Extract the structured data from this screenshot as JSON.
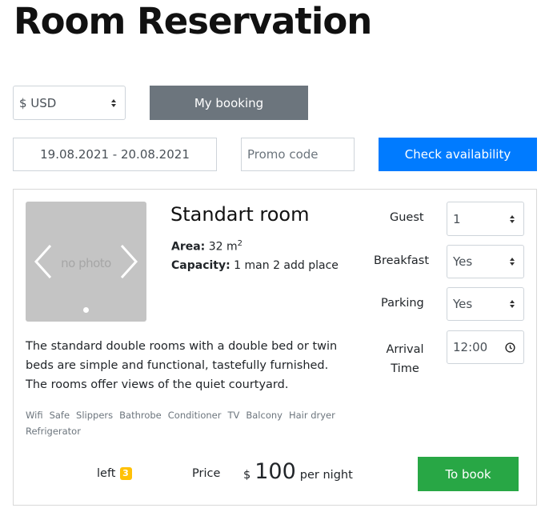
{
  "page": {
    "title": "Room Reservation"
  },
  "toolbar": {
    "currency": "$ USD",
    "my_booking_label": "My booking",
    "dates": "19.08.2021 - 20.08.2021",
    "promo_placeholder": "Promo code",
    "check_label": "Check availability"
  },
  "room": {
    "name": "Standart room",
    "photo_text": "no photo",
    "area_label": "Area:",
    "area_value": "32 m",
    "area_sup": "2",
    "capacity_label": "Capacity:",
    "capacity_value": "1 man 2 add place",
    "description": "The standard double rooms with a double bed or twin beds are simple and functional, tastefully furnished. The rooms offer views of the quiet courtyard.",
    "amenities": [
      "Wifi",
      "Safe",
      "Slippers",
      "Bathrobe",
      "Conditioner",
      "TV",
      "Balcony",
      "Hair dryer",
      "Refrigerator"
    ]
  },
  "options": {
    "guest_label": "Guest",
    "guest_value": "1",
    "breakfast_label": "Breakfast",
    "breakfast_value": "Yes",
    "parking_label": "Parking",
    "parking_value": "Yes",
    "arrival_label_1": "Arrival",
    "arrival_label_2": "Time",
    "arrival_value": "12:00"
  },
  "footer": {
    "left_label": "left",
    "left_count": "3",
    "price_label": "Price",
    "currency_symbol": "$",
    "price_value": "100",
    "per_night": "per night",
    "book_label": "To book"
  },
  "colors": {
    "grey_button": "#6c757d",
    "blue_button": "#007bff",
    "green_button": "#28a745",
    "badge": "#ffc107"
  }
}
